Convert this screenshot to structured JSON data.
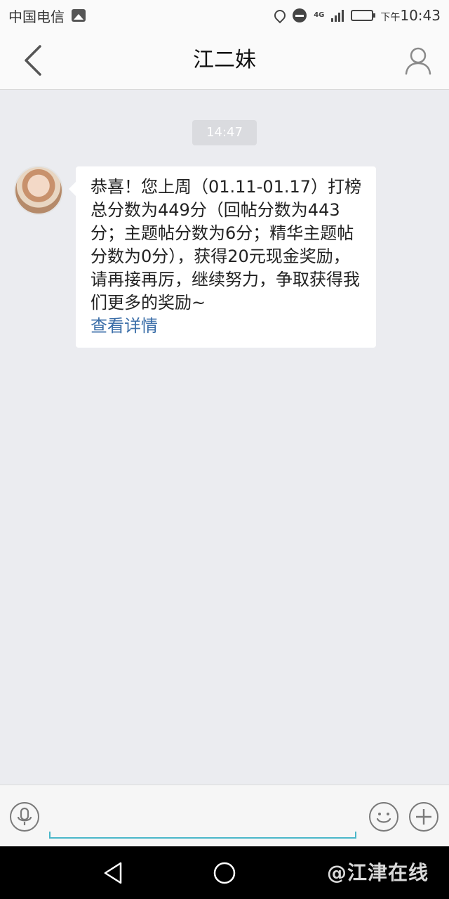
{
  "status_bar": {
    "carrier": "中国电信",
    "network": "4G",
    "time_prefix": "下午",
    "time": "10:43"
  },
  "nav": {
    "title": "江二妹",
    "back_icon": "chevron-left-icon",
    "profile_icon": "user-icon"
  },
  "chat": {
    "timestamp": "14:47",
    "messages": [
      {
        "sender": "江二妹",
        "text": "恭喜！您上周（01.11-01.17）打榜总分数为449分（回帖分数为443分；主题帖分数为6分；精华主题帖分数为0分），获得20元现金奖励，请再接再厉，继续努力，争取获得我们更多的奖励~",
        "link": "查看详情"
      }
    ]
  },
  "input_bar": {
    "voice_icon": "microphone-icon",
    "emoji_icon": "emoji-icon",
    "plus_icon": "plus-icon",
    "placeholder": ""
  },
  "watermark": "@江津在线",
  "colors": {
    "background": "#ebecf0",
    "link": "#3b6ea8",
    "input_underline": "#4ab7c9"
  }
}
